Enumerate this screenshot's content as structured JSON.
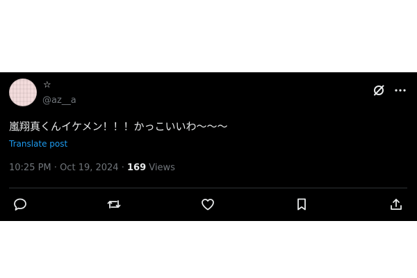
{
  "author": {
    "display_name": "☆",
    "handle": "@az__a"
  },
  "tweet": {
    "text": "嵐翔真くんイケメン！！！かっこいいわ〜〜〜",
    "translate_label": "Translate post",
    "time": "10:25 PM",
    "date": "Oct 19, 2024",
    "separator": "·",
    "views_count": "169",
    "views_label": "Views"
  },
  "icons": {
    "grok": "grok-icon",
    "more": "more-icon",
    "reply": "reply-icon",
    "repost": "repost-icon",
    "like": "like-icon",
    "bookmark": "bookmark-icon",
    "share": "share-icon"
  },
  "colors": {
    "background": "#000000",
    "text": "#e7e9ea",
    "muted": "#71767b",
    "link": "#1d9bf0",
    "divider": "#2f3336"
  }
}
